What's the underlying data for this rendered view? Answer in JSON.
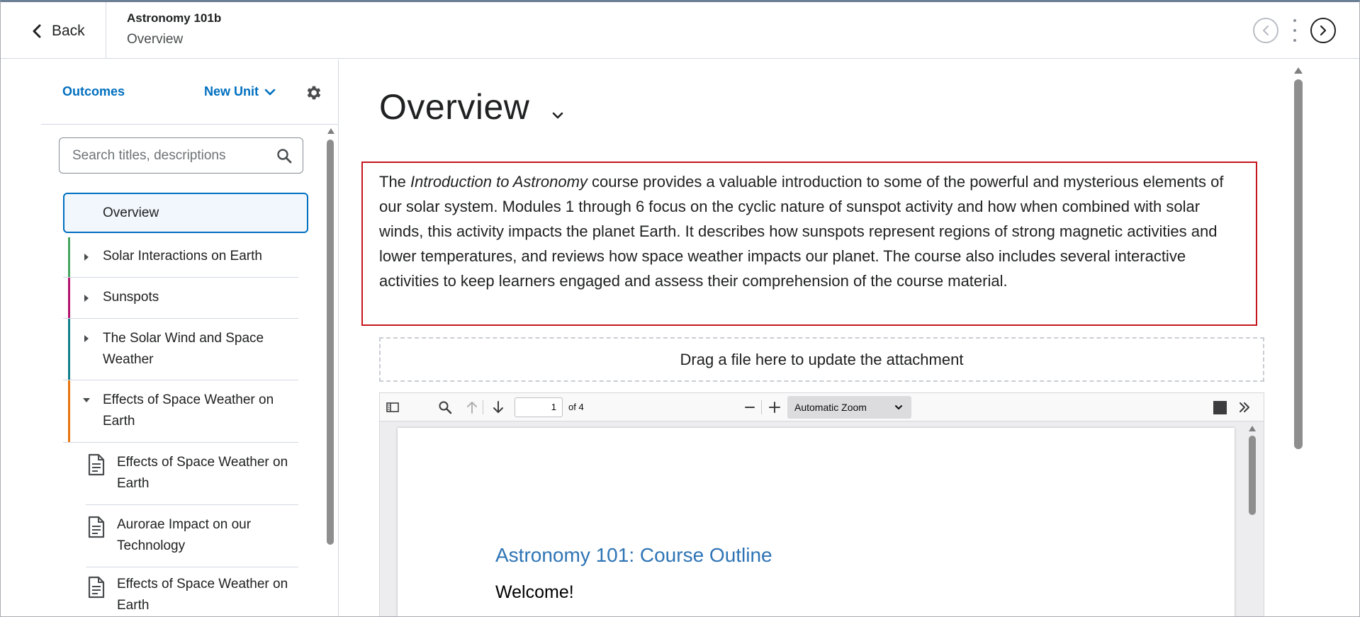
{
  "topbar": {
    "back_label": "Back",
    "course_title": "Astronomy 101b",
    "course_subtitle": "Overview",
    "icons": [
      "chevron-left-icon",
      "prev-circle-icon",
      "kebab-icon",
      "next-circle-icon"
    ]
  },
  "sidebar": {
    "outcomes_label": "Outcomes",
    "new_unit_label": "New Unit",
    "search_placeholder": "Search titles, descriptions",
    "colors": {
      "link": "#006fbf",
      "selected_border": "#006fbf"
    },
    "items": [
      {
        "label": "Overview",
        "selected": true
      },
      {
        "label": "Solar Interactions on Earth",
        "expander": "collapsed",
        "color": "#46a661"
      },
      {
        "label": "Sunspots",
        "expander": "collapsed",
        "color": "#b5156f"
      },
      {
        "label": "The Solar Wind and Space Weather",
        "expander": "collapsed",
        "color": "#14808a"
      },
      {
        "label": "Effects of Space Weather on Earth",
        "expander": "expanded",
        "color": "#e87511"
      },
      {
        "label": "Effects of Space Weather on Earth",
        "type": "document"
      },
      {
        "label": "Aurorae Impact on our Technology",
        "type": "document"
      },
      {
        "label": "Effects of Space Weather on Earth",
        "type": "document"
      }
    ]
  },
  "main": {
    "title": "Overview",
    "description": {
      "prefix": "The ",
      "italic": "Introduction to Astronomy",
      "suffix": " course provides a valuable introduction to some of the powerful and mysterious elements of our solar system. Modules 1 through 6 focus on the cyclic nature of sunspot activity and how when combined with solar winds, this activity impacts the planet Earth. It describes how sunspots represent regions of strong magnetic activities and lower temperatures, and reviews how space weather impacts our planet. The course also includes several interactive activities to keep learners engaged and assess their comprehension of the course material.",
      "border_color": "#c5161d"
    },
    "dropzone_label": "Drag a file here to update the attachment",
    "viewer": {
      "page_number": "1",
      "page_count": "of 4",
      "zoom": "Automatic Zoom",
      "pdf_heading": "Astronomy 101: Course Outline",
      "pdf_welcome": "Welcome!",
      "heading_color": "#2e74b5"
    }
  }
}
